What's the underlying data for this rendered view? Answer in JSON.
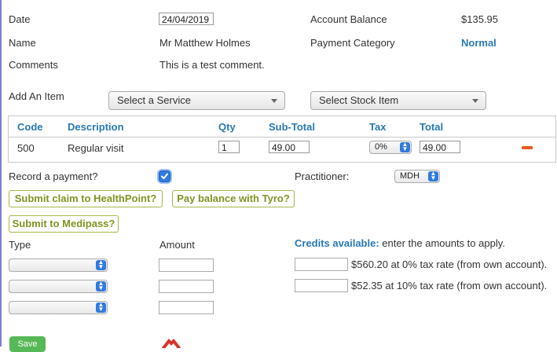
{
  "header": {
    "date_label": "Date",
    "date_value": "24/04/2019",
    "name_label": "Name",
    "name_value": "Mr Matthew Holmes",
    "comments_label": "Comments",
    "comments_value": "This is a test comment.",
    "balance_label": "Account Balance",
    "balance_value": "$135.95",
    "category_label": "Payment Category",
    "category_value": "Normal"
  },
  "add_item": {
    "label": "Add An Item",
    "service_select": "Select a Service",
    "stock_select": "Select Stock Item"
  },
  "table": {
    "columns": [
      "Code",
      "Description",
      "Qty",
      "Sub-Total",
      "Tax",
      "Total"
    ],
    "rows": [
      {
        "code": "500",
        "description": "Regular visit",
        "qty": "1",
        "subtotal": "49.00",
        "tax": "0%",
        "total": "49.00"
      }
    ]
  },
  "payment": {
    "record_label": "Record a payment?",
    "record_checked": true,
    "practitioner_label": "Practitioner:",
    "practitioner_value": "MDH",
    "healthpoint_button": "Submit claim to HealthPoint?",
    "tyro_button": "Pay balance with Tyro?",
    "medipass_button": "Submit to Medipass?",
    "type_label": "Type",
    "amount_label": "Amount",
    "credits_title": "Credits available:",
    "credits_hint": "enter the amounts to apply.",
    "credits": [
      "$560.20 at 0% tax rate (from own account).",
      "$52.35 at 10% tax rate (from own account)."
    ]
  },
  "footer": {
    "save_label": "Save"
  },
  "colors": {
    "accent_blue": "#2a78b5",
    "button_green": "#7f9422",
    "checkbox_blue": "#2f7be0",
    "remove_orange": "#e65c1e"
  }
}
